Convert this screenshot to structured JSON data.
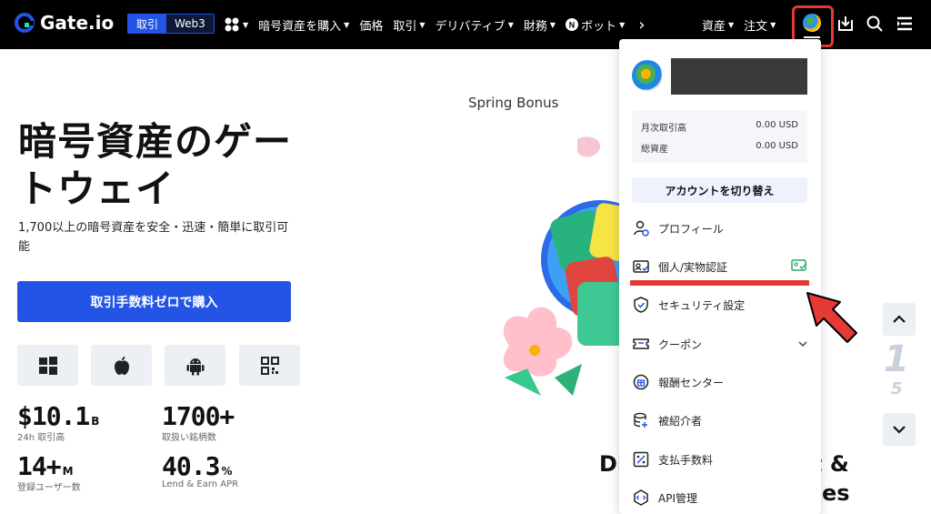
{
  "header": {
    "logo_text": "Gate.io",
    "segment": [
      "取引",
      "Web3"
    ],
    "nav": [
      "暗号資産を購入",
      "価格",
      "取引",
      "デリバティブ",
      "財務",
      "ボット"
    ],
    "more": "›",
    "right": [
      "資産",
      "注文"
    ]
  },
  "hero": {
    "title_line1": "暗号資産のゲー",
    "title_line2": "トウェイ",
    "subtitle": "1,700以上の暗号資産を安全・迅速・簡単に取引可能",
    "cta": "取引手数料ゼロで購入",
    "stats": [
      {
        "value": "$10.1",
        "unit": "B",
        "label": "24h 取引高"
      },
      {
        "value": "1700+",
        "unit": "",
        "label": "取扱い銘柄数"
      },
      {
        "value": "14+",
        "unit": "M",
        "label": "登録ユーザー数"
      },
      {
        "value": "40.3",
        "unit": "%",
        "label": "Lend & Earn APR"
      }
    ]
  },
  "center": {
    "spring": "Spring Bonus",
    "partial1": "Di",
    "partial2": "t &",
    "partial3": "es"
  },
  "carousel": {
    "digit_main": "1",
    "digit_sub": "5"
  },
  "dropdown": {
    "monthly_label": "月次取引高",
    "monthly_value": "0.00 USD",
    "total_label": "総資産",
    "total_value": "0.00 USD",
    "switch": "アカウントを切り替え",
    "items": [
      "プロフィール",
      "個人/実物認証",
      "セキュリティ設定",
      "クーポン",
      "報酬センター",
      "被紹介者",
      "支払手数料",
      "API管理"
    ]
  },
  "colors": {
    "accent": "#2354e6",
    "highlight": "#e53935"
  }
}
